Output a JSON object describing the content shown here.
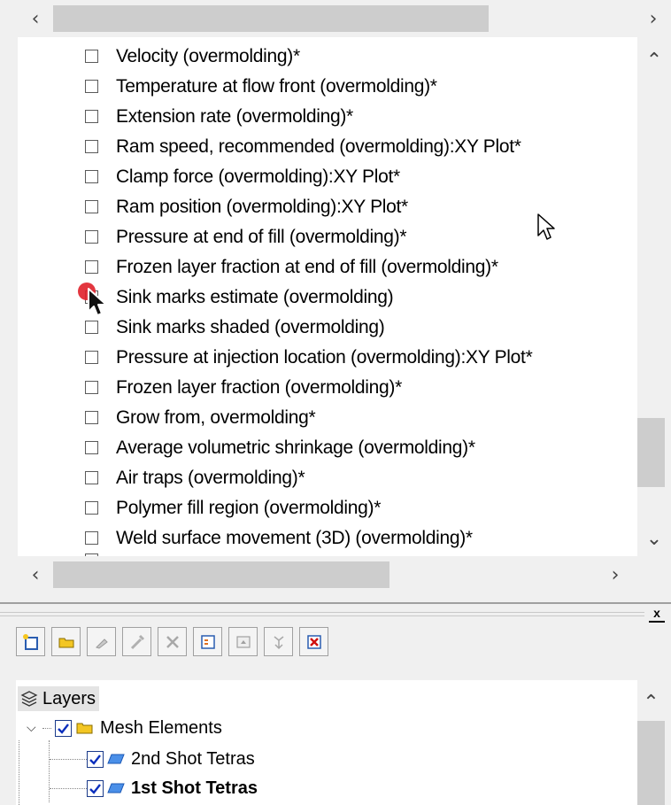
{
  "results": {
    "items": [
      {
        "label": "Velocity (overmolding)*"
      },
      {
        "label": "Temperature at flow front (overmolding)*"
      },
      {
        "label": "Extension rate (overmolding)*"
      },
      {
        "label": "Ram speed, recommended (overmolding):XY Plot*"
      },
      {
        "label": "Clamp force (overmolding):XY Plot*"
      },
      {
        "label": "Ram position (overmolding):XY Plot*"
      },
      {
        "label": "Pressure at end of fill (overmolding)*"
      },
      {
        "label": "Frozen layer fraction at end of fill (overmolding)*"
      },
      {
        "label": "Sink marks estimate (overmolding)"
      },
      {
        "label": "Sink marks shaded (overmolding)"
      },
      {
        "label": "Pressure at injection location (overmolding):XY Plot*"
      },
      {
        "label": "Frozen layer fraction (overmolding)*"
      },
      {
        "label": "Grow from, overmolding*"
      },
      {
        "label": "Average volumetric shrinkage (overmolding)*"
      },
      {
        "label": "Air traps (overmolding)*"
      },
      {
        "label": "Polymer fill region (overmolding)*"
      },
      {
        "label": "Weld surface movement (3D) (overmolding)*"
      }
    ]
  },
  "scrollbars": {
    "left_arrow": "<",
    "right_arrow": ">",
    "up_arrow": "^",
    "down_arrow": "v"
  },
  "panel": {
    "close_label": "x"
  },
  "toolbar": {
    "icons": [
      "new-layer-icon",
      "folder-icon",
      "brush-icon",
      "wrench-icon",
      "scissors-icon",
      "layer-properties-icon",
      "minimize-icon",
      "expand-icon",
      "delete-layer-icon"
    ]
  },
  "layers": {
    "header": "Layers",
    "group": {
      "label": "Mesh Elements",
      "checked": true
    },
    "children": [
      {
        "label": "2nd Shot Tetras",
        "checked": true,
        "bold": false
      },
      {
        "label": "1st Shot Tetras",
        "checked": true,
        "bold": true
      }
    ]
  },
  "colors": {
    "checkbox_border": "#1a3a8a",
    "check_mark": "#0b2fbd",
    "folder": "#f3c623",
    "layer_icon": "#4a8fe8",
    "pointer_dot": "#e0202a"
  }
}
